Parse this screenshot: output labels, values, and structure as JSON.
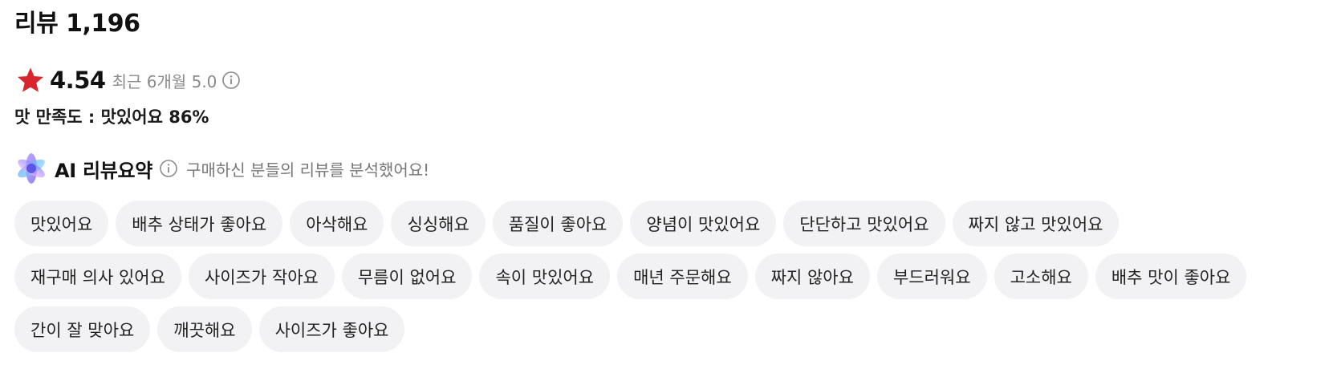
{
  "header": {
    "title": "리뷰 1,196"
  },
  "rating": {
    "star_icon": "star-icon",
    "star_color": "#d8262e",
    "value": "4.54",
    "recent_text": "최근 6개월 5.0",
    "info_icon": "info-icon"
  },
  "satisfaction": {
    "text": "맛 만족도 : 맛있어요 86%"
  },
  "ai_summary": {
    "logo_icon": "ai-sparkle-logo-icon",
    "title": "AI 리뷰요약",
    "info_icon": "info-icon",
    "description": "구매하신 분들의 리뷰를 분석했어요!"
  },
  "chips": {
    "rows": [
      [
        "맛있어요",
        "배추 상태가 좋아요",
        "아삭해요",
        "싱싱해요",
        "품질이 좋아요",
        "양념이 맛있어요",
        "단단하고 맛있어요",
        "짜지 않고 맛있어요"
      ],
      [
        "재구매 의사 있어요",
        "사이즈가 작아요",
        "무름이 없어요",
        "속이 맛있어요",
        "매년 주문해요",
        "짜지 않아요",
        "부드러워요",
        "고소해요",
        "배추 맛이 좋아요"
      ],
      [
        "간이 잘 맞아요",
        "깨끗해요",
        "사이즈가 좋아요"
      ]
    ],
    "chip_background": "#f2f2f4"
  }
}
